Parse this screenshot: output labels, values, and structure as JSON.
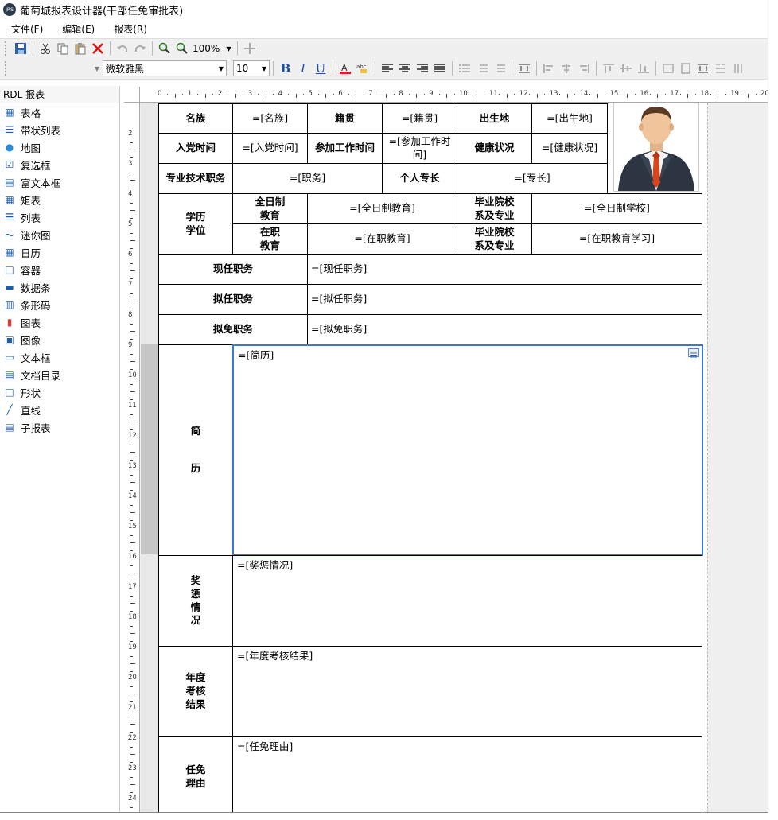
{
  "title": {
    "logo": "JRS",
    "text": "葡萄城报表设计器(干部任免审批表)"
  },
  "menu": [
    "文件(F)",
    "编辑(E)",
    "报表(R)"
  ],
  "toolbar": {
    "zoom": "100%",
    "font_name": "微软雅黑",
    "font_size": "10"
  },
  "sidebar": {
    "header": "RDL 报表",
    "items": [
      {
        "label": "表格",
        "icon": "table-icon"
      },
      {
        "label": "带状列表",
        "icon": "banded-list-icon"
      },
      {
        "label": "地图",
        "icon": "map-icon"
      },
      {
        "label": "复选框",
        "icon": "checkbox-icon"
      },
      {
        "label": "富文本框",
        "icon": "rich-textbox-icon"
      },
      {
        "label": "矩表",
        "icon": "matrix-icon"
      },
      {
        "label": "列表",
        "icon": "list-icon"
      },
      {
        "label": "迷你图",
        "icon": "sparkline-icon"
      },
      {
        "label": "日历",
        "icon": "calendar-icon"
      },
      {
        "label": "容器",
        "icon": "container-icon"
      },
      {
        "label": "数据条",
        "icon": "databar-icon"
      },
      {
        "label": "条形码",
        "icon": "barcode-icon"
      },
      {
        "label": "图表",
        "icon": "chart-icon"
      },
      {
        "label": "图像",
        "icon": "image-icon"
      },
      {
        "label": "文本框",
        "icon": "textbox-icon"
      },
      {
        "label": "文档目录",
        "icon": "toc-icon"
      },
      {
        "label": "形状",
        "icon": "shape-icon"
      },
      {
        "label": "直线",
        "icon": "line-icon"
      },
      {
        "label": "子报表",
        "icon": "subreport-icon"
      }
    ]
  },
  "ruler": {
    "h": [
      "0",
      "1",
      "2",
      "3",
      "4",
      "5",
      "6",
      "7",
      "8",
      "9",
      "10",
      "11",
      "12",
      "13",
      "14",
      "15",
      "16",
      "17",
      "18",
      "19",
      "20"
    ],
    "v": [
      "2",
      "3",
      "4",
      "5",
      "6",
      "7",
      "8",
      "9",
      "10",
      "11",
      "12",
      "13",
      "14",
      "15",
      "16",
      "17",
      "18",
      "19",
      "20",
      "21",
      "22",
      "23",
      "24"
    ]
  },
  "form": {
    "r1": {
      "l1": "名族",
      "v1": "=[名族]",
      "l2": "籍贯",
      "v2": "=[籍贯]",
      "l3": "出生地",
      "v3": "=[出生地]"
    },
    "r2": {
      "l1": "入党时间",
      "v1": "=[入党时间]",
      "l2": "参加工作时间",
      "v2": "=[参加工作时间]",
      "l3": "健康状况",
      "v3": "=[健康状况]"
    },
    "r3": {
      "l1": "专业技术职务",
      "v1": "=[职务]",
      "l2": "个人专长",
      "v2": "=[专长]"
    },
    "edu": {
      "label_a": "学历",
      "label_b": "学位",
      "fulltime_a": "全日制",
      "fulltime_b": "教育",
      "fulltime_v": "=[全日制教育]",
      "school_a": "毕业院校",
      "school_b": "系及专业",
      "school_v": "=[全日制学校]",
      "inservice_a": "在职",
      "inservice_b": "教育",
      "inservice_v": "=[在职教育]",
      "school2_a": "毕业院校",
      "school2_b": "系及专业",
      "school2_v": "=[在职教育学习]"
    },
    "current": {
      "label": "现任职务",
      "value": "=[现任职务]"
    },
    "proposed": {
      "label": "拟任职务",
      "value": "=[拟任职务]"
    },
    "removal": {
      "label": "拟免职务",
      "value": "=[拟免职务]"
    },
    "resume": {
      "c1": "简",
      "c2": "历",
      "value": "=[简历]"
    },
    "awards": {
      "c1": "奖",
      "c2": "惩",
      "c3": "情",
      "c4": "况",
      "value": "=[奖惩情况]"
    },
    "annual": {
      "c1": "年度",
      "c2": "考核",
      "c3": "结果",
      "value": "=[年度考核结果]"
    },
    "reason": {
      "c1": "任免",
      "c2": "理由",
      "value": "=[任免理由]"
    }
  }
}
